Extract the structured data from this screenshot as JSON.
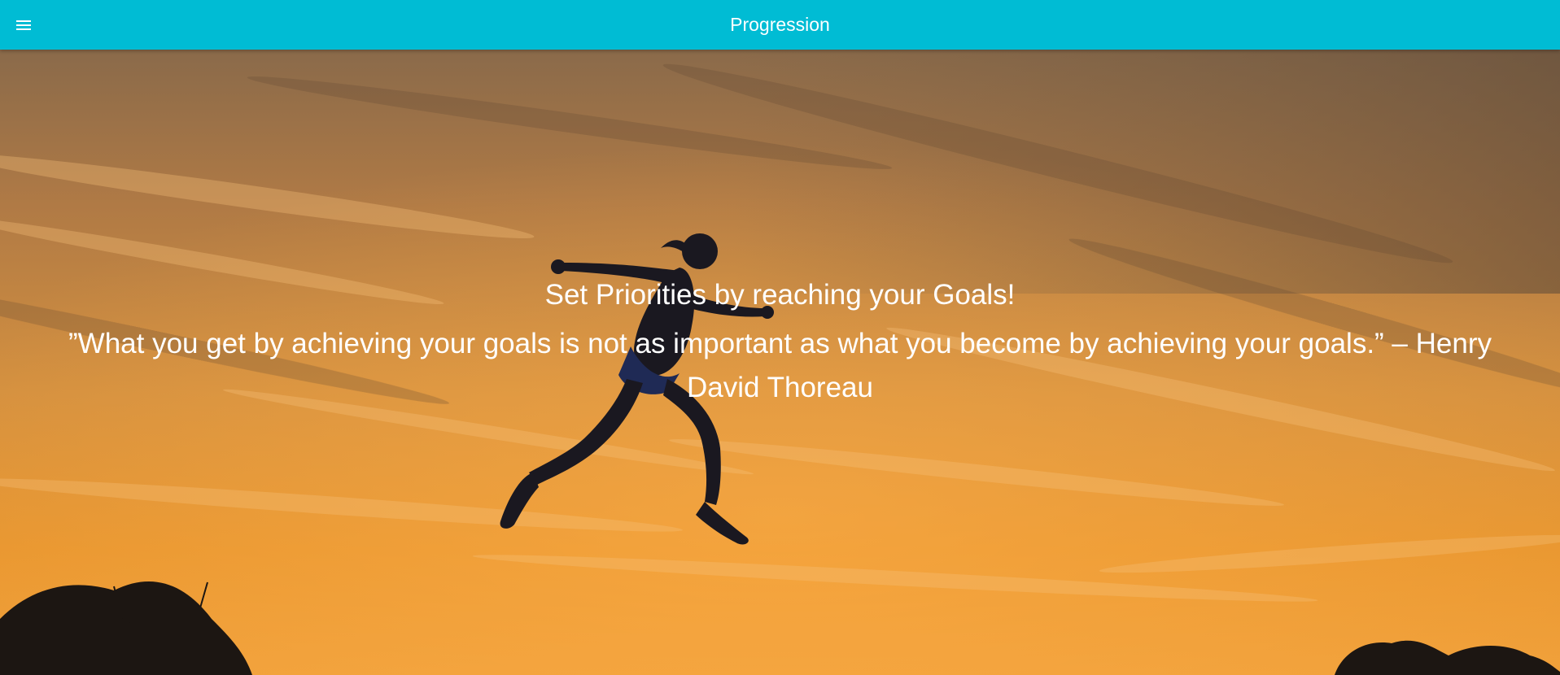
{
  "toolbar": {
    "title": "Progression",
    "menu_icon": "menu-icon",
    "background_color": "#00bcd4",
    "text_color": "#ffffff"
  },
  "hero": {
    "heading": "Set Priorities by reaching your Goals!",
    "quote": "”What you get by achieving your goals is not as important as what you become by achieving your goals.” – Henry David Thoreau",
    "text_color": "#ffffff"
  }
}
